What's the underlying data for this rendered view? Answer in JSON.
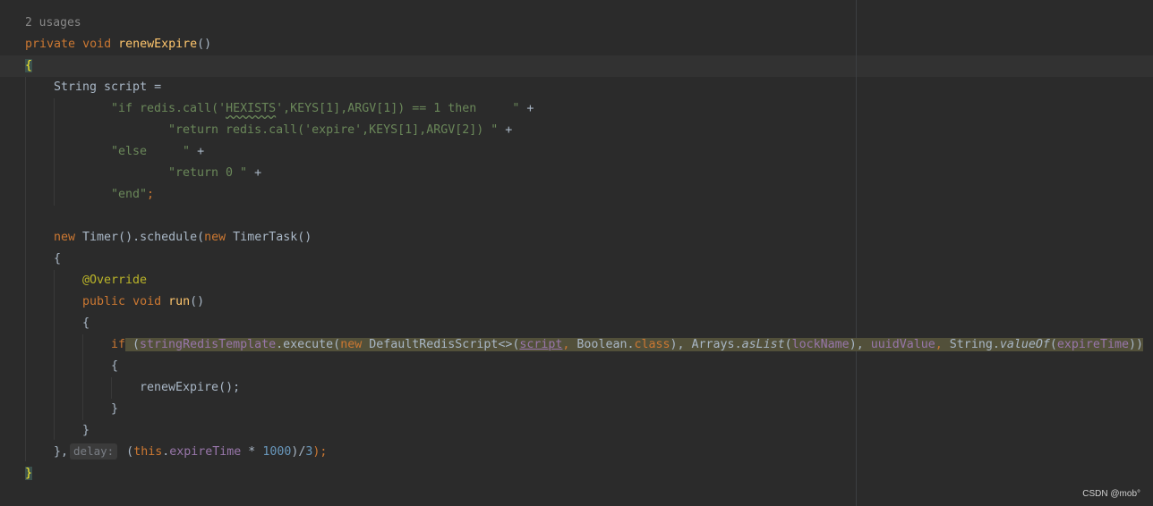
{
  "editor": {
    "usages": "2 usages",
    "method": {
      "kw_private": "private",
      "kw_void": "void",
      "name": "renewExpire",
      "parens": "()"
    },
    "open_brace": "{",
    "close_brace": "}",
    "script_decl": "String script =",
    "lua_lines": [
      {
        "pre": "\"if redis.call('",
        "hl": "HEXISTS",
        "post": "',KEYS[1],ARGV[1]) == 1 then     \"",
        "op": " +"
      },
      {
        "text": "\"return redis.call('expire',KEYS[1],ARGV[2]) \"",
        "op": " +"
      },
      {
        "text": "\"else     \"",
        "op": " +"
      },
      {
        "text": "\"return 0 \"",
        "op": " +"
      },
      {
        "text": "\"end\"",
        "op": ";"
      }
    ],
    "timer": {
      "kw_new": "new",
      "timer_call": " Timer().schedule(",
      "kw_new2": "new",
      "task": " TimerTask()"
    },
    "brace": "{",
    "brace_close": "}",
    "override": "@Override",
    "run": {
      "kw_public": "public",
      "kw_void": "void",
      "name": "run",
      "parens": "()"
    },
    "if_line": {
      "kw_if": "if",
      "paren_open": " (",
      "field": "stringRedisTemplate",
      "execute": ".execute(",
      "kw_new": "new",
      "script_class": " DefaultRedisScript<>(",
      "script_var": "script",
      "comma1": ", ",
      "boolean": "Boolean.",
      "kw_class": "class",
      "close1": "), ",
      "arrays": "Arrays.",
      "aslist": "asList",
      "paren2": "(",
      "lockname": "lockName",
      "close2": "), ",
      "uuid": "uuidValue",
      "comma2": ", ",
      "string_cls": "String.",
      "valueof": "valueOf",
      "paren3": "(",
      "expire": "expireTime",
      "close3": "))"
    },
    "renew_call": "renewExpire",
    "renew_tail": "();",
    "end_line": {
      "close": "},",
      "hint": "delay:",
      "paren": " (",
      "kw_this": "this",
      "dot": ".",
      "field": "expireTime",
      "op": " * ",
      "num": "1000",
      "tail": ")/",
      "num2": "3",
      "end": ");"
    }
  },
  "watermark": "CSDN @mob°",
  "colors": {
    "background": "#2b2b2b",
    "keyword": "#cc7832",
    "function": "#ffc66d",
    "string": "#6a8759",
    "field": "#9876aa",
    "number": "#6897bb",
    "annotation": "#bbb529"
  }
}
